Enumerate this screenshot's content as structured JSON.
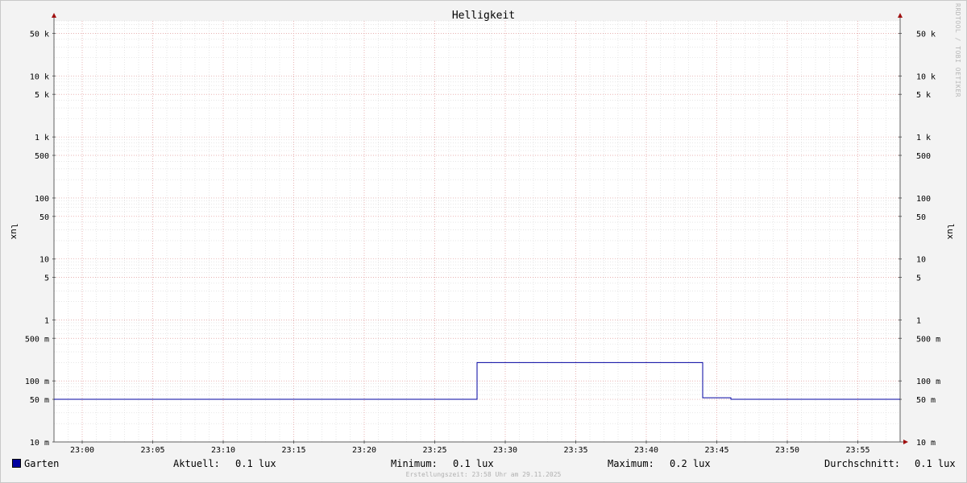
{
  "chart_data": {
    "type": "line",
    "title": "Helligkeit",
    "ylabel": "lux",
    "y_scale": "log",
    "ylim": [
      0.01,
      80000
    ],
    "xlim": [
      "22:58",
      "23:58"
    ],
    "grid": true,
    "y_ticks": [
      {
        "value": 0.01,
        "label": "10 m"
      },
      {
        "value": 0.05,
        "label": "50 m"
      },
      {
        "value": 0.1,
        "label": "100 m"
      },
      {
        "value": 0.5,
        "label": "500 m"
      },
      {
        "value": 1,
        "label": "1"
      },
      {
        "value": 5,
        "label": "5"
      },
      {
        "value": 10,
        "label": "10"
      },
      {
        "value": 50,
        "label": "50"
      },
      {
        "value": 100,
        "label": "100"
      },
      {
        "value": 500,
        "label": "500"
      },
      {
        "value": 1000,
        "label": "1 k"
      },
      {
        "value": 5000,
        "label": "5 k"
      },
      {
        "value": 10000,
        "label": "10 k"
      },
      {
        "value": 50000,
        "label": "50 k"
      }
    ],
    "x_ticks": [
      "23:00",
      "23:05",
      "23:10",
      "23:15",
      "23:20",
      "23:25",
      "23:30",
      "23:35",
      "23:40",
      "23:45",
      "23:50",
      "23:55"
    ],
    "series": [
      {
        "name": "Garten",
        "color": "#0000a0",
        "points": [
          {
            "t": "22:58",
            "v": 0.05
          },
          {
            "t": "23:28",
            "v": 0.05
          },
          {
            "t": "23:28",
            "v": 0.2
          },
          {
            "t": "23:44",
            "v": 0.2
          },
          {
            "t": "23:44",
            "v": 0.053
          },
          {
            "t": "23:46",
            "v": 0.053
          },
          {
            "t": "23:46",
            "v": 0.05
          },
          {
            "t": "23:58",
            "v": 0.05
          }
        ]
      }
    ]
  },
  "legend": {
    "series_name": "Garten",
    "current_label": "Aktuell:",
    "current_value": "0.1 lux",
    "min_label": "Minimum:",
    "min_value": "0.1 lux",
    "max_label": "Maximum:",
    "max_value": "0.2 lux",
    "avg_label": "Durchschnitt:",
    "avg_value": "0.1 lux"
  },
  "footer": "Erstellungszeit: 23:58 Uhr am 29.11.2025",
  "watermark": "RRDTOOL / TOBI OETIKER"
}
